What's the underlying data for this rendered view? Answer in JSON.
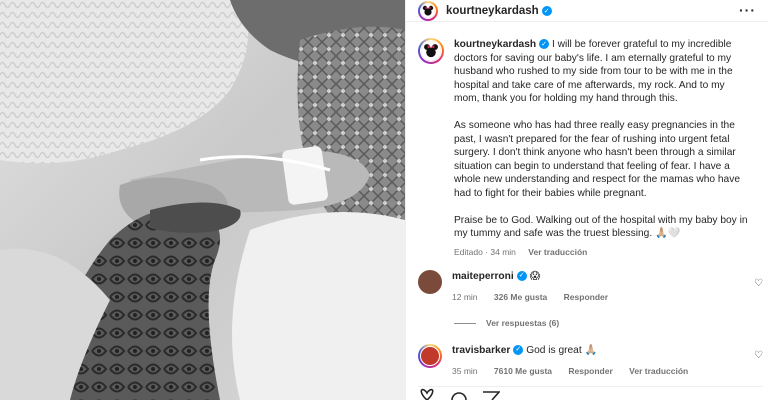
{
  "post": {
    "username": "kourtneykardash",
    "more_icon": "more-horizontal-icon"
  },
  "caption": {
    "paragraphs": [
      "I will be forever grateful to my incredible doctors for saving our baby's life. I am eternally grateful to my husband who rushed to my side from tour to be with me in the hospital and take care of me afterwards, my rock. And to my mom, thank you for holding my hand through this.",
      "As someone who has had three really easy pregnancies in the past, I wasn't prepared for the fear of rushing into urgent fetal surgery. I don't think anyone who hasn't been through a similar situation can begin to understand that feeling of fear. I have a whole new understanding and respect for the mamas who have had to fight for their babies while pregnant.",
      "Praise be to God. Walking out of the hospital with my baby boy in my tummy and safe was the truest blessing. 🙏🏼🤍"
    ],
    "edited": "Editado · 34 min",
    "translate": "Ver traducción"
  },
  "comments": [
    {
      "username": "maiteperroni",
      "text": "😱",
      "time": "12 min",
      "likes": "326 Me gusta",
      "reply": "Responder"
    },
    {
      "username": "travisbarker",
      "text": "God is great 🙏🏼",
      "time": "35 min",
      "likes": "7610 Me gusta",
      "reply": "Responder",
      "translate": "Ver traducción"
    }
  ],
  "replies_label": "Ver respuestas (6)",
  "colors": {
    "verified": "#0095f6",
    "text": "#262626",
    "muted": "#737373"
  }
}
